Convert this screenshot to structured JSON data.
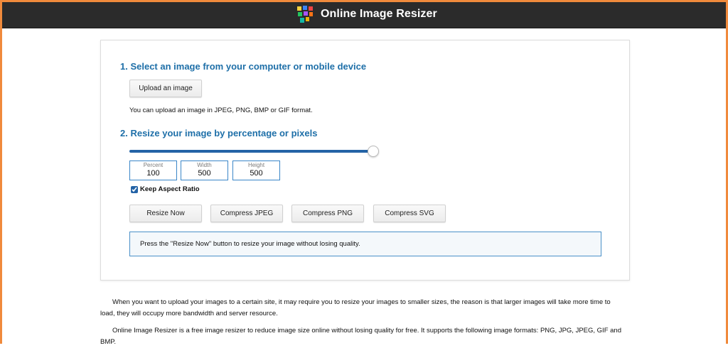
{
  "header": {
    "title": "Online Image Resizer",
    "colors": {
      "bar": "#2b2b2b",
      "frame": "#f08a3c"
    },
    "logo_icon": "image-tiles-icon"
  },
  "step1": {
    "title": "1. Select an image from your computer or mobile device",
    "upload_label": "Upload an image",
    "note": "You can upload an image in JPEG, PNG, BMP or GIF format."
  },
  "step2": {
    "title": "2. Resize your image by percentage or pixels",
    "slider_value_percent": 100,
    "fields": {
      "percent": {
        "label": "Percent",
        "value": "100"
      },
      "width": {
        "label": "Width",
        "value": "500"
      },
      "height": {
        "label": "Height",
        "value": "500"
      }
    },
    "keep_aspect": {
      "label": "Keep Aspect Ratio",
      "checked": true
    },
    "buttons": {
      "resize": "Resize Now",
      "compress_jpeg": "Compress JPEG",
      "compress_png": "Compress PNG",
      "compress_svg": "Compress SVG"
    },
    "info": "Press the \"Resize Now\" button to resize your image without losing quality."
  },
  "content": {
    "paragraph1": "When you want to upload your images to a certain site, it may require you to resize your images to smaller sizes, the reason is that larger images will take more time to load, they will occupy more bandwidth and server resource.",
    "paragraph2": "Online Image Resizer is a free image resizer to reduce image size online without losing quality for free. It supports the following image formats: PNG, JPG, JPEG, GIF and BMP."
  }
}
